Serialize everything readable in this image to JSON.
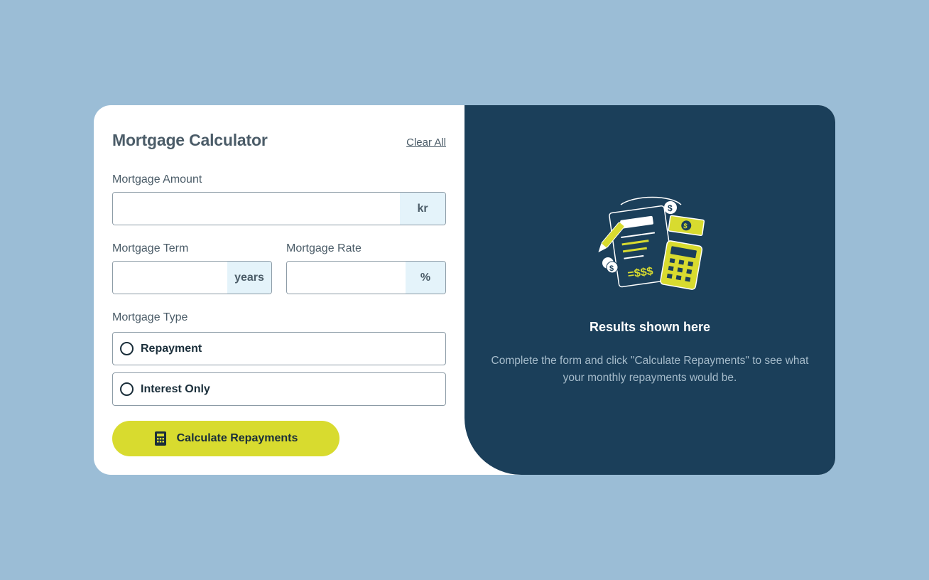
{
  "form": {
    "title": "Mortgage Calculator",
    "clear_label": "Clear All",
    "amount": {
      "label": "Mortgage Amount",
      "unit": "kr",
      "value": ""
    },
    "term": {
      "label": "Mortgage Term",
      "unit": "years",
      "value": ""
    },
    "rate": {
      "label": "Mortgage Rate",
      "unit": "%",
      "value": ""
    },
    "type": {
      "label": "Mortgage Type",
      "options": [
        {
          "label": "Repayment",
          "selected": false
        },
        {
          "label": "Interest Only",
          "selected": false
        }
      ]
    },
    "submit_label": "Calculate Repayments",
    "submit_icon": "calculator-icon"
  },
  "results": {
    "title": "Results shown here",
    "description": "Complete the form and click \"Calculate Repayments\" to see what your monthly repayments would be.",
    "illustration": "empty-results-illustration"
  },
  "colors": {
    "background": "#9bbdd6",
    "results_panel": "#1b3f5a",
    "accent_lime": "#d8db2f",
    "unit_bg": "#e4f3fa",
    "text_slate": "#4b5c68"
  }
}
